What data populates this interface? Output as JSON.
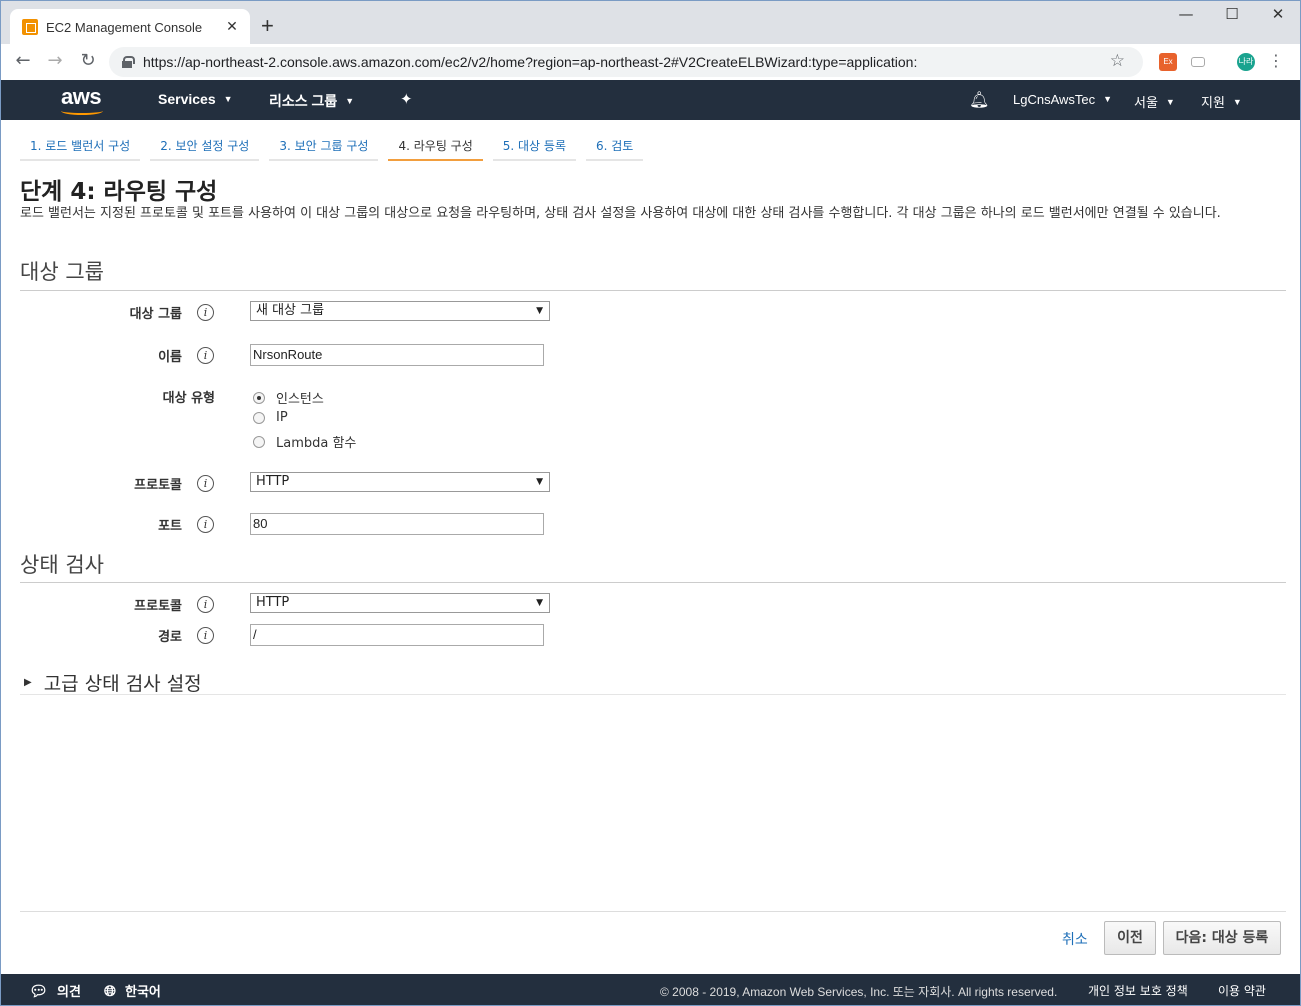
{
  "browser": {
    "tab_title": "EC2 Management Console",
    "tab_close": "✕",
    "new_tab": "+",
    "url": "https://ap-northeast-2.console.aws.amazon.com/ec2/v2/home?region=ap-northeast-2#V2CreateELBWizard:type=application:",
    "minimize": "—",
    "maximize": "☐",
    "close": "✕",
    "ext1": "Ex",
    "ext3": "나라"
  },
  "awsnav": {
    "logo": "aws",
    "services": "Services",
    "resource_groups": "리소스 그룹",
    "account": "LgCnsAwsTec",
    "region": "서울",
    "support": "지원"
  },
  "steps": [
    "1. 로드 밸런서 구성",
    "2. 보안 설정 구성",
    "3. 보안 그룹 구성",
    "4. 라우팅 구성",
    "5. 대상 등록",
    "6. 검토"
  ],
  "page": {
    "title": "단계 4: 라우팅 구성",
    "description": "로드 밸런서는 지정된 프로토콜 및 포트를 사용하여 이 대상 그룹의 대상으로 요청을 라우팅하며, 상태 검사 설정을 사용하여 대상에 대한 상태 검사를 수행합니다. 각 대상 그룹은 하나의 로드 밸런서에만 연결될 수 있습니다."
  },
  "target_group": {
    "section_title": "대상 그룹",
    "target_group_label": "대상 그룹",
    "target_group_value": "새 대상 그룹",
    "name_label": "이름",
    "name_value": "NrsonRoute",
    "target_type_label": "대상 유형",
    "target_types": [
      "인스턴스",
      "IP",
      "Lambda 함수"
    ],
    "selected_target_type": "인스턴스",
    "protocol_label": "프로토콜",
    "protocol_value": "HTTP",
    "port_label": "포트",
    "port_value": "80"
  },
  "health_check": {
    "section_title": "상태 검사",
    "protocol_label": "프로토콜",
    "protocol_value": "HTTP",
    "path_label": "경로",
    "path_value": "/",
    "advanced_label": "고급 상태 검사 설정"
  },
  "actions": {
    "cancel": "취소",
    "previous": "이전",
    "next": "다음: 대상 등록"
  },
  "footer": {
    "feedback": "의견",
    "language": "한국어",
    "copyright": "© 2008 - 2019, Amazon Web Services, Inc. 또는 자회사. All rights reserved.",
    "privacy": "개인 정보 보호 정책",
    "terms": "이용 약관"
  },
  "colors": {
    "nav_bg": "#232f3e",
    "link": "#1e6fb8",
    "active_step": "#f29e3e",
    "aws_orange": "#ff9900"
  }
}
